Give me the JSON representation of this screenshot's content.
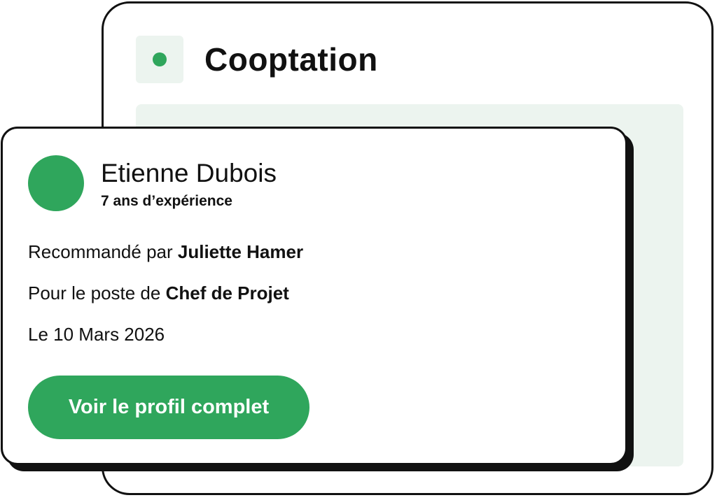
{
  "panel": {
    "title": "Cooptation",
    "icon": "dot-icon"
  },
  "card": {
    "candidate_name": "Etienne Dubois",
    "candidate_experience": "7 ans d’expérience",
    "recommended_prefix": "Recommandé par ",
    "recommended_by": "Juliette Hamer",
    "position_prefix": "Pour le poste de ",
    "position": "Chef de Projet",
    "date_text": "Le 10 Mars 2026",
    "button_label": "Voir le profil complet"
  },
  "colors": {
    "accent": "#2fa65c",
    "panel_fill": "#ecf4ef",
    "border": "#111111",
    "background": "#ffffff"
  }
}
